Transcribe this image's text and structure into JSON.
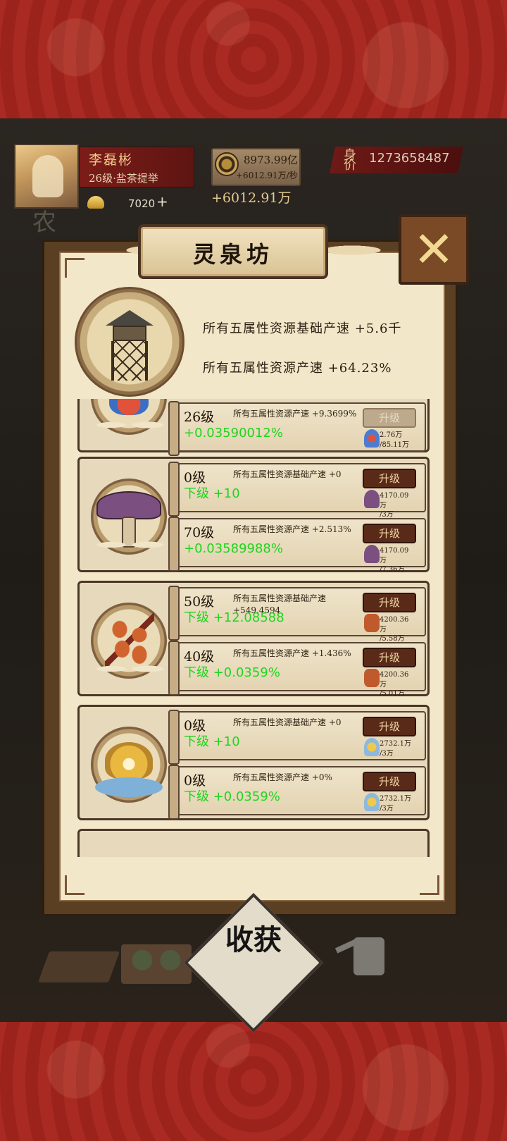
{
  "header": {
    "player_name": "李磊彬",
    "player_rank": "26级·盐茶提举",
    "gold": "7020",
    "gold_plus": "+",
    "coins": "8973.99亿",
    "coin_rate": "+6012.91万/秒",
    "income_total": "+6012.91万",
    "worth_label": "身价",
    "worth_value": "1273658487",
    "bg_char": "农"
  },
  "panel": {
    "title": "灵泉坊",
    "close_icon": "✕",
    "summary_base": "所有五属性资源基础产速 +5.6千",
    "summary_rate": "所有五属性资源产速 +64.23%"
  },
  "cards": [
    {
      "name": "flower",
      "rows": [
        {
          "level": "26级",
          "desc": "所有五属性资源产速 +9.3699%",
          "green": "+0.03590012%",
          "button": "升级",
          "enabled": false,
          "cost_have": "2.76万",
          "cost_need": "/85.11万"
        }
      ]
    },
    {
      "name": "mushroom",
      "rows": [
        {
          "level": "0级",
          "desc": "所有五属性资源基础产速 +0",
          "green": "下级 +10",
          "button": "升级",
          "enabled": true,
          "cost_have": "4170.09万",
          "cost_need": "/3万"
        },
        {
          "level": "70级",
          "desc": "所有五属性资源产速 +2.513%",
          "green": "+0.03589988%",
          "button": "升级",
          "enabled": true,
          "cost_have": "4170.09万",
          "cost_need": "/7.36万"
        }
      ]
    },
    {
      "name": "herb",
      "rows": [
        {
          "level": "50级",
          "desc": "所有五属性资源基础产速 +549.4594",
          "green": "下级 +12.08588",
          "button": "升级",
          "enabled": true,
          "cost_have": "4200.36万",
          "cost_need": "/5.58万"
        },
        {
          "level": "40级",
          "desc": "所有五属性资源产速 +1.436%",
          "green": "下级 +0.0359%",
          "button": "升级",
          "enabled": true,
          "cost_have": "4200.36万",
          "cost_need": "/5.01万"
        }
      ]
    },
    {
      "name": "lotus",
      "rows": [
        {
          "level": "0级",
          "desc": "所有五属性资源基础产速 +0",
          "green": "下级 +10",
          "button": "升级",
          "enabled": true,
          "cost_have": "2732.1万",
          "cost_need": "/3万"
        },
        {
          "level": "0级",
          "desc": "所有五属性资源产速 +0%",
          "green": "下级 +0.0359%",
          "button": "升级",
          "enabled": true,
          "cost_have": "2732.1万",
          "cost_need": "/3万"
        }
      ]
    }
  ],
  "footer": {
    "harvest_label": "收获"
  },
  "colors": {
    "accent_red": "#a92a22",
    "parchment": "#f3e7ca",
    "overlay_green": "#1fd51f"
  }
}
